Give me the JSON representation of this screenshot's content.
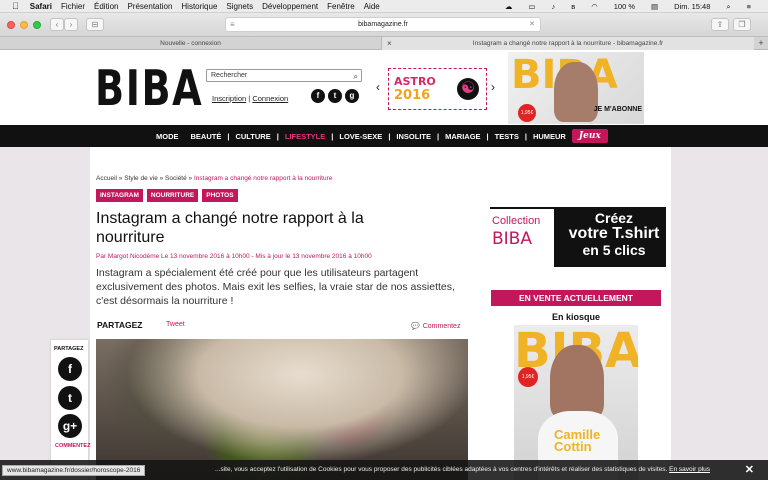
{
  "menubar": {
    "apple": "",
    "app": "Safari",
    "items": [
      "Fichier",
      "Édition",
      "Présentation",
      "Historique",
      "Signets",
      "Développement",
      "Fenêtre",
      "Aide"
    ],
    "battery": "100 %",
    "clock": "Dim. 15:48"
  },
  "browser": {
    "url": "bibamagazine.fr",
    "tabs": [
      "Nouvelle - connexion",
      "Instagram a changé notre rapport à la nourriture - bibamagazine.fr"
    ],
    "back": "‹",
    "forward": "›",
    "sidebar": "⊟",
    "status_url": "www.bibamagazine.fr/dossier/horoscope-2016"
  },
  "header": {
    "logo": "BIBA",
    "search_placeholder": "Rechercher",
    "inscription": "Inscription",
    "separator": "|",
    "connexion": "Connexion",
    "social": [
      "f",
      "t",
      "g"
    ],
    "astro_title": "ASTRO",
    "astro_year": "2016",
    "mag_top_cta": "JE M'ABONNE",
    "mag_top_price": "1,95€"
  },
  "nav": {
    "items": [
      "MODE",
      "BEAUTÉ",
      "CULTURE",
      "LIFESTYLE",
      "LOVE-SEXE",
      "INSOLITE",
      "MARIAGE",
      "TESTS",
      "HUMEUR"
    ],
    "jeux": "Jeux"
  },
  "article": {
    "breadcrumb": [
      "Accueil",
      "Style de vie",
      "Société",
      "Instagram a changé notre rapport à la nourriture"
    ],
    "tags": [
      "INSTAGRAM",
      "NOURRITURE",
      "PHOTOS"
    ],
    "title": "Instagram a changé notre rapport à la nourriture",
    "byline": "Par Margot Nicodème Le 13 novembre 2016 à 10h00 - Mis à jour le 13 novembre 2016 à 10h00",
    "lead": "Instagram a spécialement été créé pour que les utilisateurs partagent exclusivement des photos. Mais exit les selfies, la vraie star de nos assiettes, c'est désormais la nourriture !",
    "partagez": "PARTAGEZ",
    "tweet": "Tweet",
    "commentez": "Commentez"
  },
  "sharebar": {
    "label": "PARTAGEZ",
    "comment_label": "COMMENTEZ"
  },
  "sidebar": {
    "promo_line1": "Collection",
    "promo_line2": "BIBA",
    "promo_cta1": "Créez",
    "promo_cta2": "votre T.shirt",
    "promo_cta3": "en 5 clics",
    "vente": "EN VENTE ACTUELLEMENT",
    "kiosque": "En kiosque",
    "mag_name1": "Camille",
    "mag_name2": "Cottin",
    "mag_price": "1,95€"
  },
  "cookie": {
    "message": "...site, vous acceptez l'utilisation de Cookies pour vous proposer des publicités ciblées adaptées à vos centres d'intérêts et réaliser des statistiques de visites.",
    "link": "En savoir plus",
    "close": "✕"
  }
}
